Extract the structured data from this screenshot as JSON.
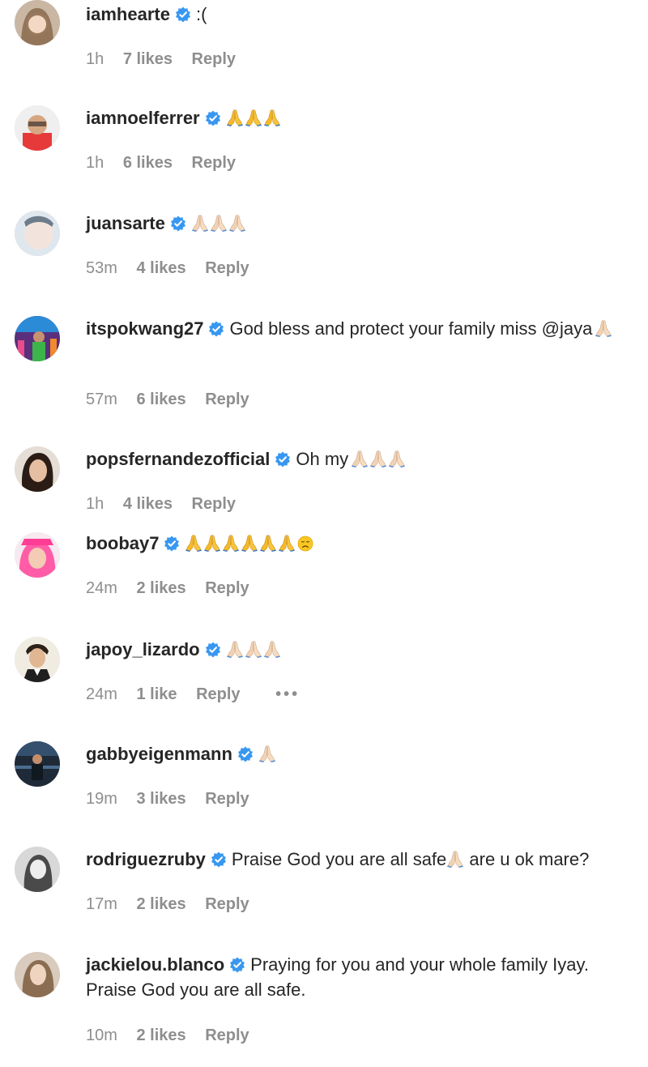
{
  "comments": [
    {
      "username": "iamhearte",
      "text": ":(",
      "emoji": [],
      "time": "1h",
      "likes": "7 likes",
      "reply": "Reply"
    },
    {
      "username": "iamnoelferrer",
      "text": "",
      "emoji": [
        "pray-yellow",
        "pray-yellow",
        "pray-yellow"
      ],
      "time": "1h",
      "likes": "6 likes",
      "reply": "Reply"
    },
    {
      "username": "juansarte",
      "text": "",
      "emoji": [
        "pray-light",
        "pray-light",
        "pray-light"
      ],
      "time": "53m",
      "likes": "4 likes",
      "reply": "Reply"
    },
    {
      "username": "itspokwang27",
      "text": "God bless and protect your family miss @jaya",
      "emoji": [
        "pray-light"
      ],
      "time": "57m",
      "likes": "6 likes",
      "reply": "Reply"
    },
    {
      "username": "popsfernandezofficial",
      "text": "Oh my",
      "emoji": [
        "pray-light",
        "pray-light",
        "pray-light"
      ],
      "time": "1h",
      "likes": "4 likes",
      "reply": "Reply"
    },
    {
      "username": "boobay7",
      "text": "",
      "emoji": [
        "pray-yellow",
        "pray-yellow",
        "pray-yellow",
        "pray-yellow",
        "pray-yellow",
        "pray-yellow",
        "sad-face"
      ],
      "time": "24m",
      "likes": "2 likes",
      "reply": "Reply"
    },
    {
      "username": "japoy_lizardo",
      "text": "",
      "emoji": [
        "pray-light",
        "pray-light",
        "pray-light"
      ],
      "time": "24m",
      "likes": "1 like",
      "reply": "Reply",
      "more": "•••"
    },
    {
      "username": "gabbyeigenmann",
      "text": "",
      "emoji": [
        "pray-light"
      ],
      "time": "19m",
      "likes": "3 likes",
      "reply": "Reply"
    },
    {
      "username": "rodriguezruby",
      "text_before": "Praise God you are all safe",
      "text_after": " are u ok mare?",
      "emoji": [
        "pray-light"
      ],
      "time": "17m",
      "likes": "2 likes",
      "reply": "Reply"
    },
    {
      "username": "jackielou.blanco",
      "text": "Praying for you and your whole family Iyay. Praise God you are all safe.",
      "emoji": [],
      "time": "10m",
      "likes": "2 likes",
      "reply": "Reply"
    }
  ],
  "icons": {
    "verified": "verified-badge-icon",
    "pray_yellow": "folded-hands-yellow-emoji",
    "pray_light": "folded-hands-light-emoji",
    "sad": "disappointed-face-emoji"
  },
  "colors": {
    "verified_blue": "#3897f0",
    "meta_gray": "#8e8e8e",
    "text": "#262626"
  }
}
